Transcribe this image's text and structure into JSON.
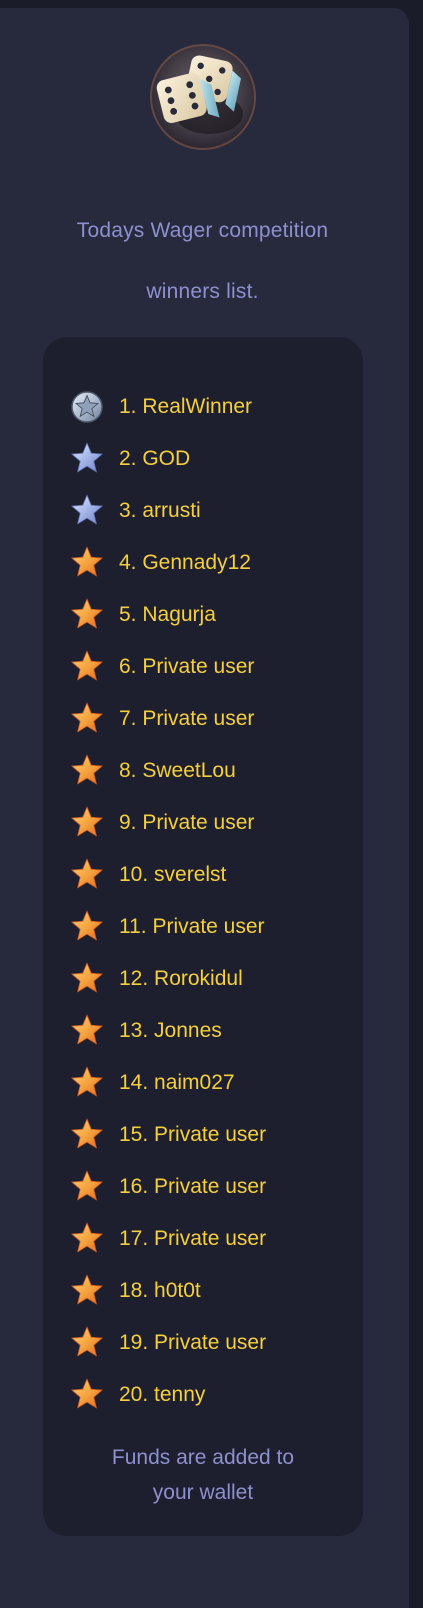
{
  "header": {
    "logo_icon": "dice-icon",
    "title_line1": "Todays Wager competition",
    "title_line2": "winners list."
  },
  "colors": {
    "background": "#1b1c2a",
    "panel": "#272a3d",
    "card": "#1e1f2e",
    "heading": "#8e8fce",
    "name": "#f5cf3d",
    "star_gold": "#f4a13d",
    "star_silver": "#9fb1e6"
  },
  "winners": [
    {
      "label": "1. RealWinner",
      "icon": "medal-star-icon"
    },
    {
      "label": "2. GOD",
      "icon": "silver-star-icon"
    },
    {
      "label": "3. arrusti",
      "icon": "silver-star-icon"
    },
    {
      "label": "4. Gennady12",
      "icon": "gold-star-icon"
    },
    {
      "label": "5. Nagurja",
      "icon": "gold-star-icon"
    },
    {
      "label": "6. Private user",
      "icon": "gold-star-icon"
    },
    {
      "label": "7. Private user",
      "icon": "gold-star-icon"
    },
    {
      "label": "8. SweetLou",
      "icon": "gold-star-icon"
    },
    {
      "label": "9. Private user",
      "icon": "gold-star-icon"
    },
    {
      "label": "10. sverelst",
      "icon": "gold-star-icon"
    },
    {
      "label": "11. Private user",
      "icon": "gold-star-icon"
    },
    {
      "label": "12. Rorokidul",
      "icon": "gold-star-icon"
    },
    {
      "label": "13. Jonnes",
      "icon": "gold-star-icon"
    },
    {
      "label": "14. naim027",
      "icon": "gold-star-icon"
    },
    {
      "label": "15. Private user",
      "icon": "gold-star-icon"
    },
    {
      "label": "16. Private user",
      "icon": "gold-star-icon"
    },
    {
      "label": "17. Private user",
      "icon": "gold-star-icon"
    },
    {
      "label": "18. h0t0t",
      "icon": "gold-star-icon"
    },
    {
      "label": "19. Private user",
      "icon": "gold-star-icon"
    },
    {
      "label": "20. tenny",
      "icon": "gold-star-icon"
    }
  ],
  "footer": {
    "line1": "Funds are added to",
    "line2": "your wallet"
  }
}
